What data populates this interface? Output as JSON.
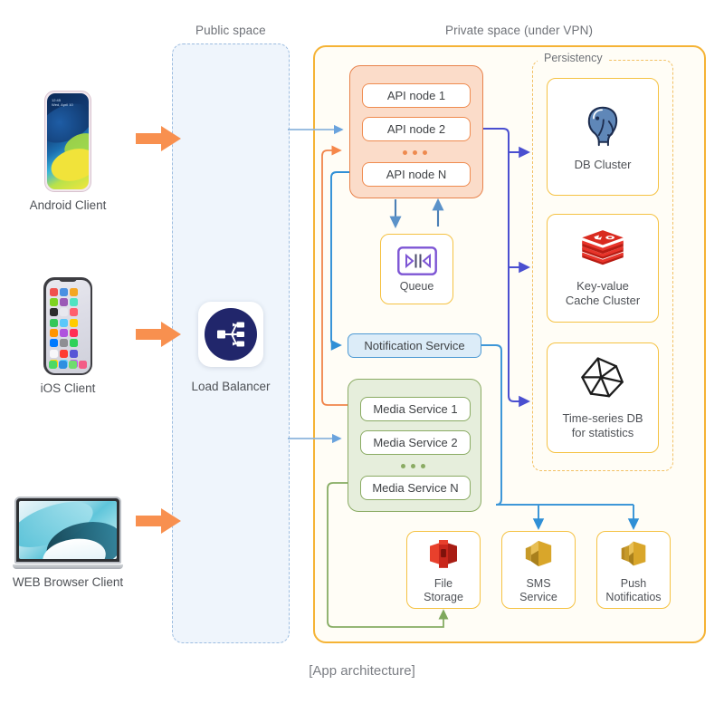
{
  "diagram": {
    "caption": "[App architecture]",
    "zones": {
      "public": {
        "label": "Public space"
      },
      "private": {
        "label": "Private space (under VPN)"
      },
      "persistency": {
        "label": "Persistency"
      }
    },
    "colors": {
      "public_fill": "#eff5fc",
      "public_border": "#9dbde0",
      "private_fill": "#fffdf6",
      "private_border": "#f5b335",
      "persistency_border": "#f2c063",
      "api_fill": "#fbdcc9",
      "api_border": "#e8834c",
      "media_fill": "#e6eedc",
      "media_border": "#8aab63",
      "notification_fill": "#dcecf8",
      "notification_border": "#4e9ad4",
      "queue_accent": "#7d55d4",
      "arrow_orange": "#f6874a",
      "arrow_blue": "#4a90d9",
      "arrow_indigo": "#4a4fd0",
      "load_balancer_circle": "#21266b",
      "card_border": "#f5c243",
      "text": "#4e5156"
    },
    "clients": [
      {
        "id": "android",
        "label": "Android Client",
        "icon": "android-phone-icon",
        "status_time": "12:45",
        "status_date": "Wed, April 10"
      },
      {
        "id": "ios",
        "label": "iOS Client",
        "icon": "iphone-icon"
      },
      {
        "id": "web",
        "label": "WEB Browser Client",
        "icon": "laptop-icon"
      }
    ],
    "load_balancer": {
      "label": "Load Balancer",
      "icon": "load-balancer-icon"
    },
    "api_group": {
      "nodes": [
        {
          "label": "API node 1"
        },
        {
          "label": "API node 2"
        },
        {
          "label": "API node N"
        }
      ],
      "ellipsis": "•••"
    },
    "queue": {
      "label": "Queue",
      "icon": "queue-icon"
    },
    "notification_service": {
      "label": "Notification Service"
    },
    "media_group": {
      "nodes": [
        {
          "label": "Media Service 1"
        },
        {
          "label": "Media Service 2"
        },
        {
          "label": "Media Service N"
        }
      ],
      "ellipsis": "•••"
    },
    "persistency_cards": [
      {
        "id": "db-cluster",
        "label": "DB Cluster",
        "icon": "postgresql-elephant-icon"
      },
      {
        "id": "cache-cluster",
        "label_line1": "Key-value",
        "label_line2": "Cache Cluster",
        "icon": "redis-icon"
      },
      {
        "id": "timeseries-db",
        "label_line1": "Time-series DB",
        "label_line2": "for statistics",
        "icon": "polyhedron-icon"
      }
    ],
    "service_cards": [
      {
        "id": "file-storage",
        "label_line1": "File",
        "label_line2": "Storage",
        "icon": "s3-bucket-icon"
      },
      {
        "id": "sms-service",
        "label_line1": "SMS",
        "label_line2": "Service",
        "icon": "sns-gold-icon"
      },
      {
        "id": "push-notifications",
        "label_line1": "Push",
        "label_line2": "Notificatios",
        "icon": "sns-gold-stack-icon"
      }
    ]
  }
}
